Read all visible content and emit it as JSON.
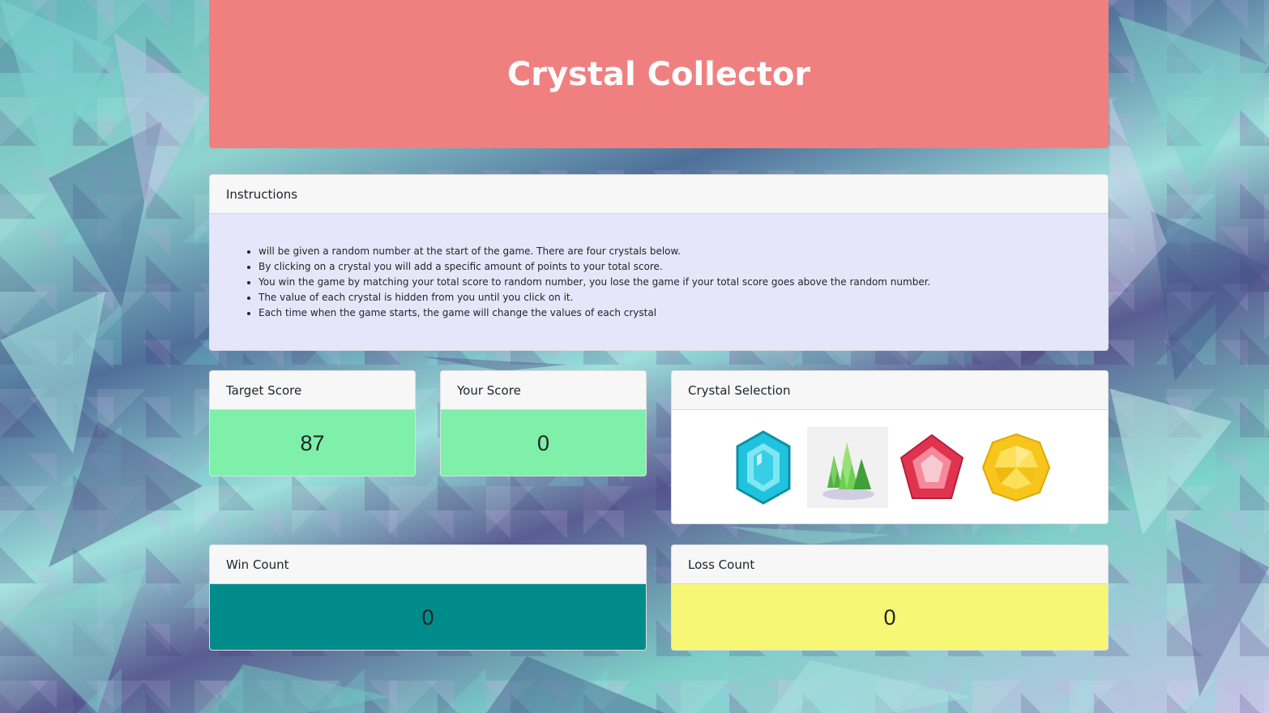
{
  "header": {
    "title": "Crystal Collector"
  },
  "instructions": {
    "heading": "Instructions",
    "items": [
      "will be given a random number at the start of the game. There are four crystals below.",
      "By clicking on a crystal you will add a specific amount of points to your total score.",
      "You win the game by matching your total score to random number, you lose the game if your total score goes above the random number.",
      "The value of each crystal is hidden from you until you click on it.",
      "Each time when the game starts, the game will change the values of each crystal"
    ]
  },
  "target": {
    "heading": "Target Score",
    "value": "87"
  },
  "score": {
    "heading": "Your Score",
    "value": "0"
  },
  "crystals": {
    "heading": "Crystal Selection",
    "items": [
      {
        "icon": "blue-gem-icon",
        "color": "#1fc3dd"
      },
      {
        "icon": "green-crystal-icon",
        "color": "#5cc34a"
      },
      {
        "icon": "red-gem-icon",
        "color": "#e0334f"
      },
      {
        "icon": "yellow-gem-icon",
        "color": "#f7c51c"
      }
    ]
  },
  "wins": {
    "heading": "Win Count",
    "value": "0"
  },
  "losses": {
    "heading": "Loss Count",
    "value": "0"
  },
  "colors": {
    "header_bg": "#f08080",
    "instructions_bg": "#e6e6fa",
    "score_bg": "#7ff0aa",
    "win_bg": "#008b8b",
    "loss_bg": "#f7f776"
  }
}
